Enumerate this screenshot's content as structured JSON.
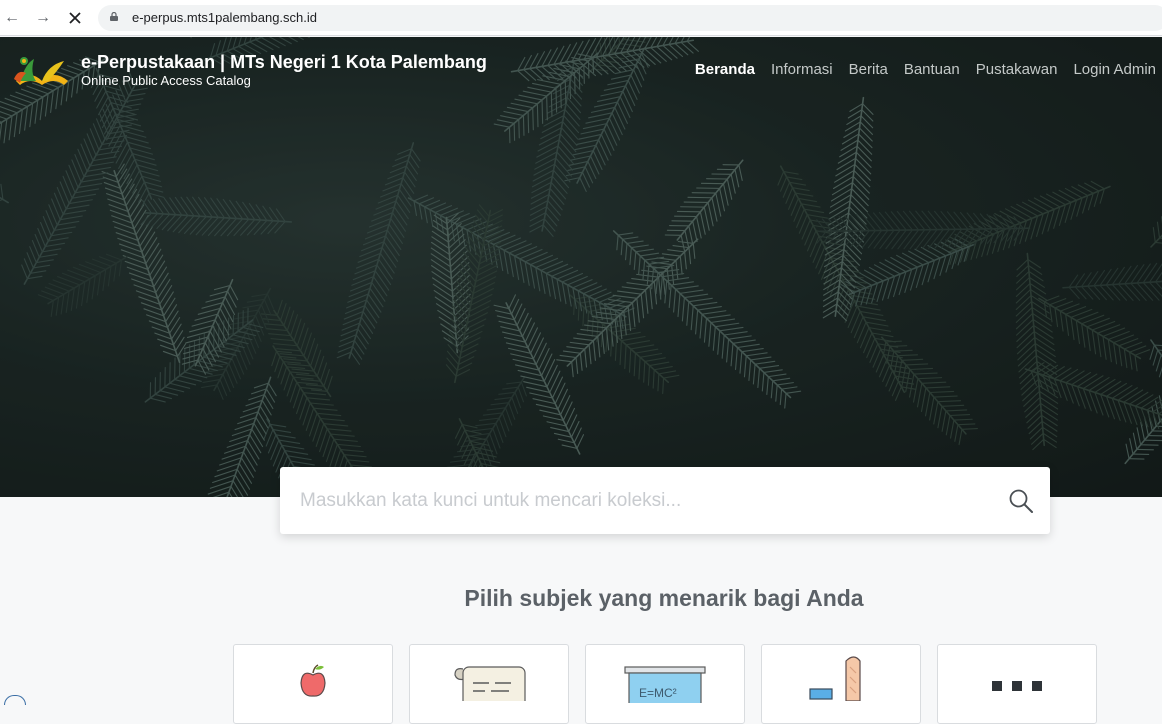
{
  "browser": {
    "url": "e-perpus.mts1palembang.sch.id"
  },
  "header": {
    "title": "e-Perpustakaan | MTs Negeri 1 Kota Palembang",
    "subtitle": "Online Public Access Catalog"
  },
  "nav": {
    "items": [
      {
        "label": "Beranda",
        "active": true
      },
      {
        "label": "Informasi",
        "active": false
      },
      {
        "label": "Berita",
        "active": false
      },
      {
        "label": "Bantuan",
        "active": false
      },
      {
        "label": "Pustakawan",
        "active": false
      },
      {
        "label": "Login Admin",
        "active": false
      }
    ]
  },
  "search": {
    "placeholder": "Masukkan kata kunci untuk mencari koleksi...",
    "value": ""
  },
  "subjects": {
    "heading": "Pilih subjek yang menarik bagi Anda",
    "cards": [
      {
        "icon": "apple-icon"
      },
      {
        "icon": "scroll-icon"
      },
      {
        "icon": "blackboard-icon"
      },
      {
        "icon": "flask-icon"
      },
      {
        "icon": "grid-icon"
      }
    ]
  },
  "colors": {
    "accent": "#ffffff",
    "muted_nav": "#c4c9c8",
    "heading": "#5b6167"
  }
}
